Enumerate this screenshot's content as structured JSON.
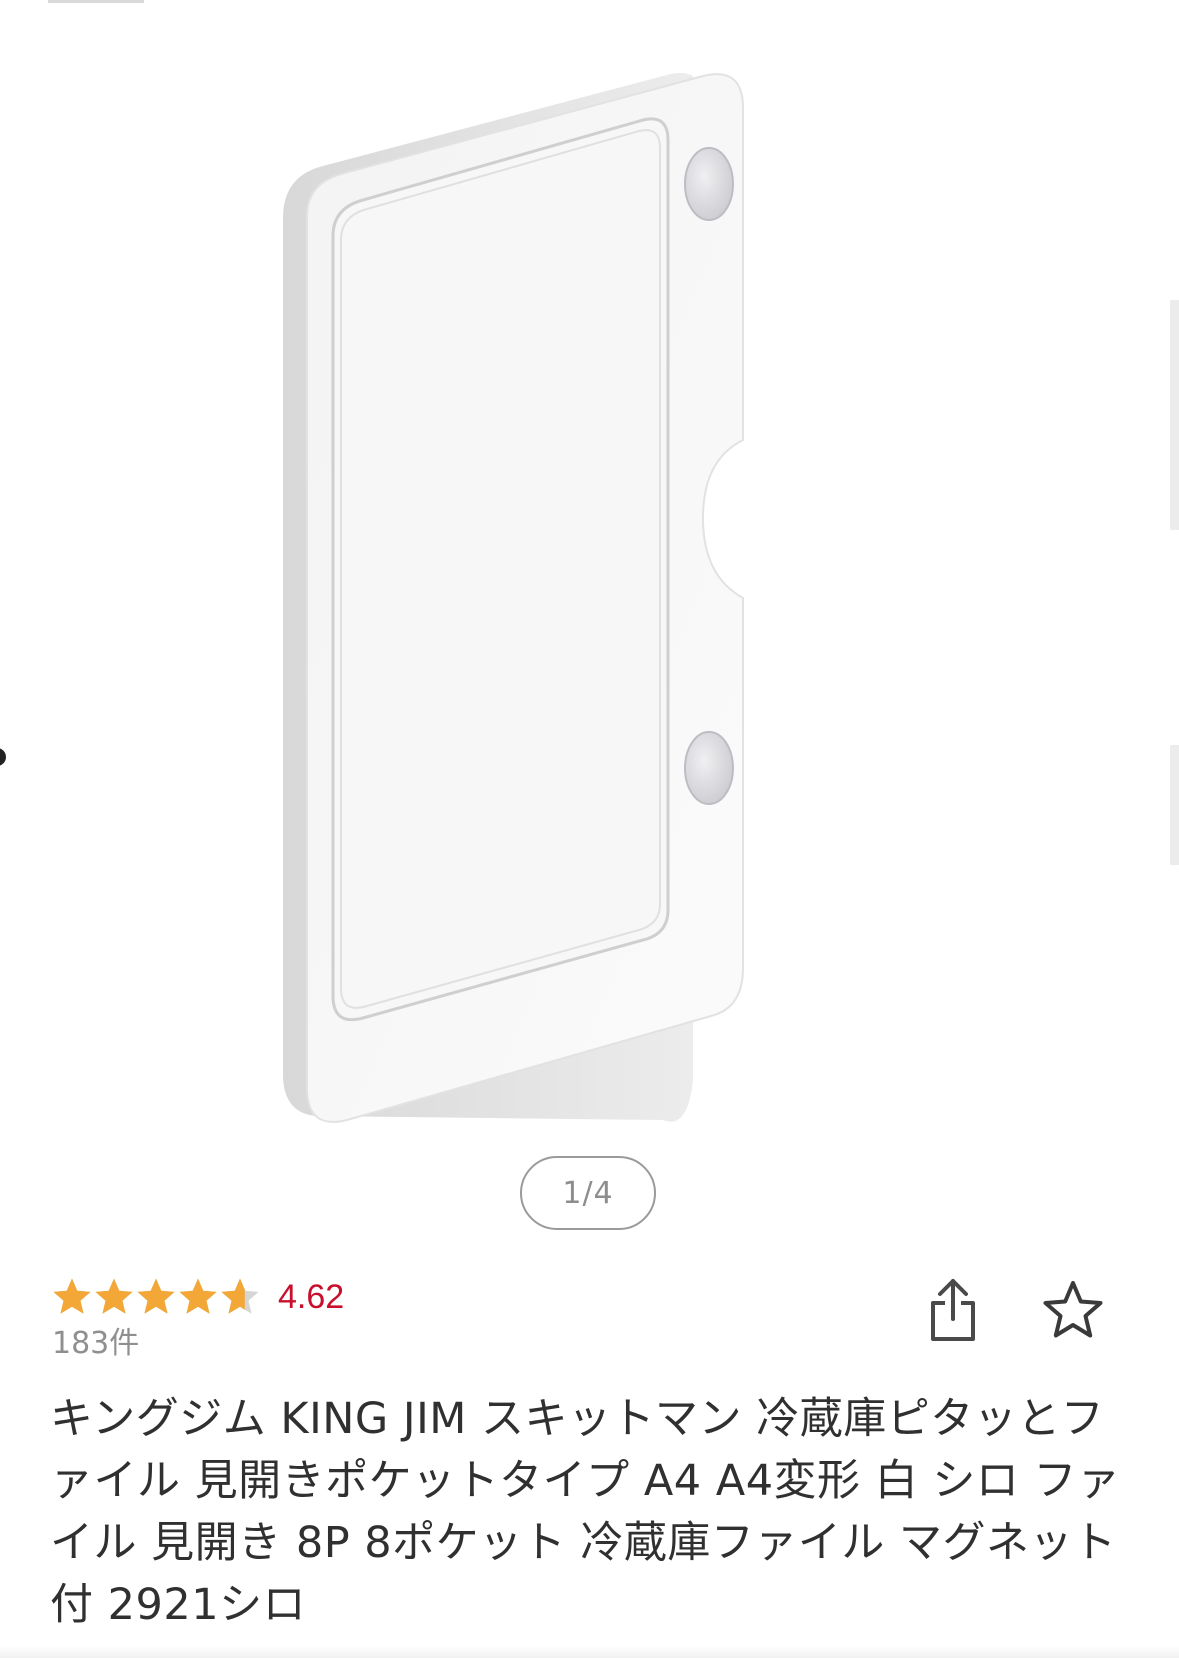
{
  "gallery": {
    "pager_label": "1/4",
    "image_icon": "magnetic-file-product-photo"
  },
  "rating": {
    "stars": 4.62,
    "max_stars": 5,
    "value_text": "4.62",
    "count_text": "183件",
    "star_color": "#f3a737",
    "star_empty_color": "#d6d6d6",
    "value_color": "#c8102e"
  },
  "actions": {
    "share_icon": "share-icon",
    "favorite_icon": "star-outline-icon"
  },
  "product": {
    "title": "キングジム KING JIM スキットマン 冷蔵庫ピタッとファイル 見開きポケットタイプ A4 A4変形 白 シロ ファイル 見開き 8P 8ポケット 冷蔵庫ファイル マグネット付 2921シロ"
  }
}
